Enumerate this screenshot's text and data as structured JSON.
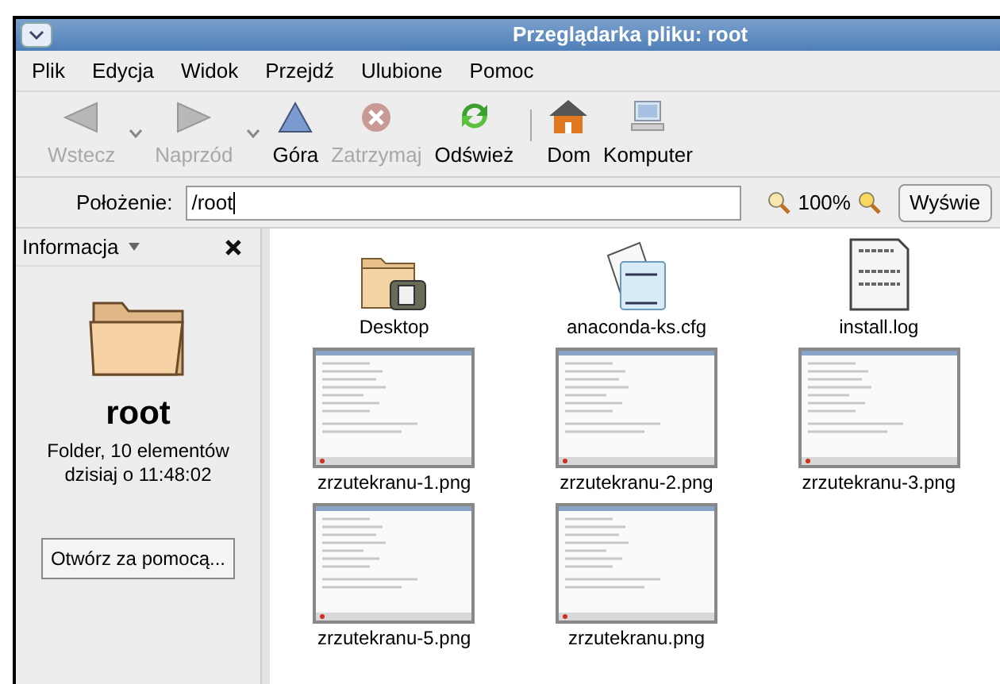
{
  "window": {
    "title": "Przeglądarka pliku: root"
  },
  "menu": [
    "Plik",
    "Edycja",
    "Widok",
    "Przejdź",
    "Ulubione",
    "Pomoc"
  ],
  "toolbar": [
    {
      "kind": "back",
      "label": "Wstecz",
      "disabled": true,
      "has_menu": true
    },
    {
      "kind": "forward",
      "label": "Naprzód",
      "disabled": true,
      "has_menu": true
    },
    {
      "kind": "up",
      "label": "Góra",
      "disabled": false,
      "has_menu": false
    },
    {
      "kind": "stop",
      "label": "Zatrzymaj",
      "disabled": true,
      "has_menu": false
    },
    {
      "kind": "reload",
      "label": "Odśwież",
      "disabled": false,
      "has_menu": false
    },
    {
      "kind": "home",
      "label": "Dom",
      "disabled": false,
      "has_menu": false
    },
    {
      "kind": "computer",
      "label": "Komputer",
      "disabled": false,
      "has_menu": false
    }
  ],
  "location_bar": {
    "label": "Położenie:",
    "value": "/root",
    "zoom": "100%",
    "view_button": "Wyświe"
  },
  "sidebar": {
    "title": "Informacja",
    "name": "root",
    "details": [
      "Folder, 10 elementów",
      "dzisiaj o 11:48:02"
    ],
    "button": "Otwórz za pomocą..."
  },
  "files": [
    {
      "kind": "folder",
      "name": "Desktop"
    },
    {
      "kind": "text",
      "name": "anaconda-ks.cfg"
    },
    {
      "kind": "log",
      "name": "install.log"
    },
    {
      "kind": "image",
      "name": "zrzutekranu-1.png"
    },
    {
      "kind": "image",
      "name": "zrzutekranu-2.png"
    },
    {
      "kind": "image",
      "name": "zrzutekranu-3.png"
    },
    {
      "kind": "image",
      "name": "zrzutekranu-5.png"
    },
    {
      "kind": "image",
      "name": "zrzutekranu.png"
    }
  ]
}
